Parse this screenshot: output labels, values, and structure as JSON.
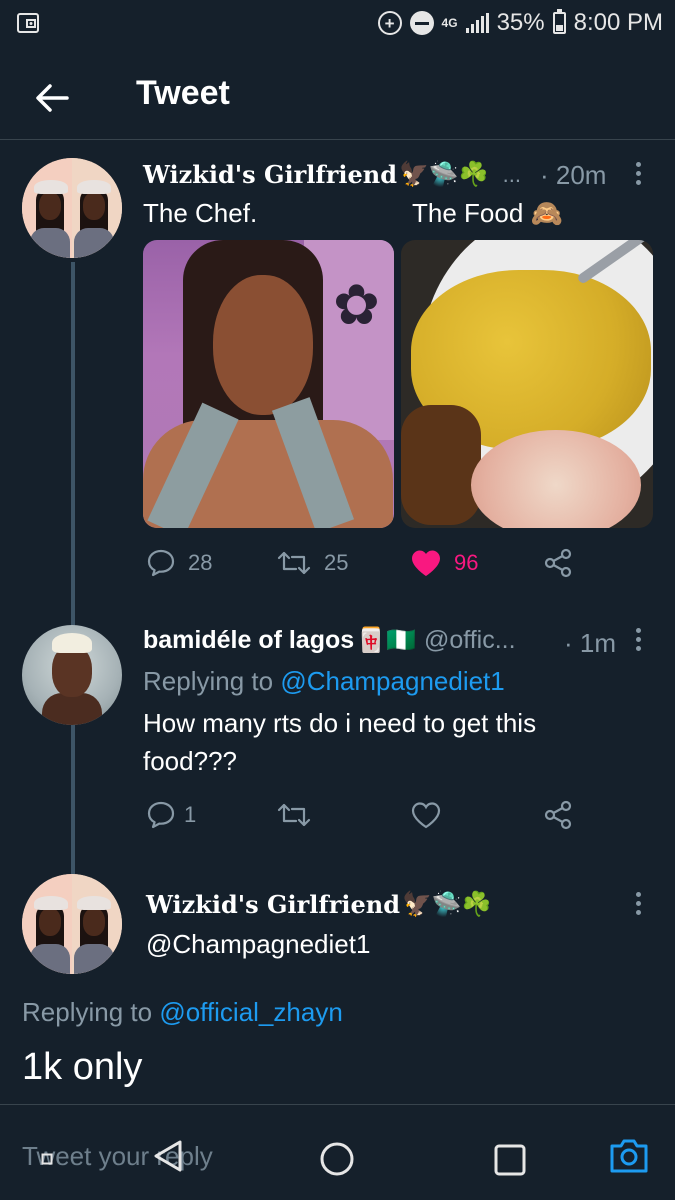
{
  "status_bar": {
    "network": "4G",
    "battery": "35%",
    "battery_level": 0.35,
    "time": "8:00 PM"
  },
  "header": {
    "title": "Tweet"
  },
  "tweets": [
    {
      "display_name": "Wizkid's Girlfriend",
      "name_emojis": "🦅🛸☘️",
      "ellipsis": "...",
      "time": "· 20m",
      "text_left": "The Chef.",
      "text_right": "The Food 🙈",
      "actions": {
        "replies": "28",
        "retweets": "25",
        "likes": "96",
        "liked": true
      }
    },
    {
      "display_name": "bamidéle of lagos",
      "name_emojis": "🀄🇳🇬",
      "handle": "@offic...",
      "time": "· 1m",
      "replying_prefix": "Replying to",
      "replying_to": "@Champagnediet1",
      "text": "How many rts do i need to get this food???",
      "actions": {
        "replies": "1",
        "retweets": "",
        "likes": "",
        "liked": false
      }
    },
    {
      "display_name": "Wizkid's Girlfriend",
      "name_emojis": "🦅🛸☘️",
      "handle": "@Champagnediet1",
      "replying_prefix": "Replying to",
      "replying_to": "@official_zhayn",
      "text": "1k only"
    }
  ],
  "reply_bar": {
    "placeholder": "Tweet your reply"
  },
  "colors": {
    "background": "#15202b",
    "divider": "#38444d",
    "muted": "#8899a6",
    "link": "#1d9bf0",
    "like": "#f91880"
  },
  "icons": [
    "screenshot-icon",
    "data-saver-icon",
    "do-not-disturb-icon",
    "signal-icon",
    "battery-icon",
    "back-arrow-icon",
    "more-icon",
    "reply-icon",
    "retweet-icon",
    "heart-icon",
    "share-icon",
    "camera-icon",
    "nav-back-icon",
    "nav-home-icon",
    "nav-recents-icon"
  ]
}
